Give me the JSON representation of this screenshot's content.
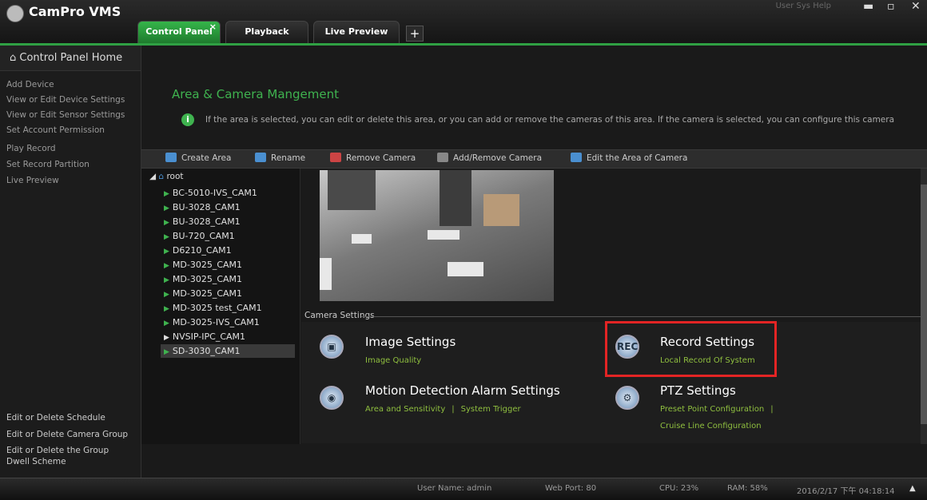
{
  "app": {
    "title": "CamPro VMS",
    "topright": "User   Sys   Help"
  },
  "tabs": [
    {
      "label": "Control Panel",
      "close": "×"
    },
    {
      "label": "Playback"
    },
    {
      "label": "Live Preview"
    }
  ],
  "tab_add": "+",
  "sidebar": {
    "home": "Control Panel Home",
    "links": [
      "Add Device",
      "View or Edit Device Settings",
      "View or Edit Sensor Settings",
      "Set Account Permission",
      "Play Record",
      "Set Record Partition",
      "Live Preview"
    ],
    "bottom_links": [
      "Edit or Delete Schedule",
      "Edit or Delete Camera Group",
      "Edit or Delete the Group",
      "Dwell Scheme"
    ]
  },
  "main": {
    "heading": "Area & Camera Mangement",
    "info": "If the area is selected, you can edit or delete this area, or you can add or remove the cameras of this area. If the camera is selected, you can configure this camera"
  },
  "toolbar": [
    "Create Area",
    "Rename",
    "Remove Camera",
    "Add/Remove Camera",
    "Edit the Area of Camera"
  ],
  "tree": {
    "root": "root",
    "items": [
      "BC-5010-IVS_CAM1",
      "BU-3028_CAM1",
      "BU-3028_CAM1",
      "BU-720_CAM1",
      "D6210_CAM1",
      "MD-3025_CAM1",
      "MD-3025_CAM1",
      "MD-3025_CAM1",
      "MD-3025 test_CAM1",
      "MD-3025-IVS_CAM1",
      "NVSIP-IPC_CAM1",
      "SD-3030_CAM1"
    ]
  },
  "camera_settings": {
    "label": "Camera Settings",
    "image": {
      "title": "Image Settings",
      "sub": "Image Quality"
    },
    "record": {
      "title": "Record Settings",
      "sub": "Local Record Of System",
      "icon_text": "REC"
    },
    "motion": {
      "title": "Motion Detection Alarm Settings",
      "sub1": "Area and Sensitivity",
      "sep": "|",
      "sub2": "System Trigger"
    },
    "ptz": {
      "title": "PTZ Settings",
      "sub1": "Preset Point Configuration",
      "sep": "|",
      "sub2": "Cruise Line Configuration"
    }
  },
  "status": {
    "user": "User Name: admin",
    "port": "Web Port: 80",
    "cpu": "CPU: 23%",
    "ram": "RAM: 58%",
    "datetime": "2016/2/17 下午 04:18:14",
    "arrow": "▲"
  },
  "colors": {
    "accent": "#3fb34f",
    "highlight": "#e32424"
  }
}
